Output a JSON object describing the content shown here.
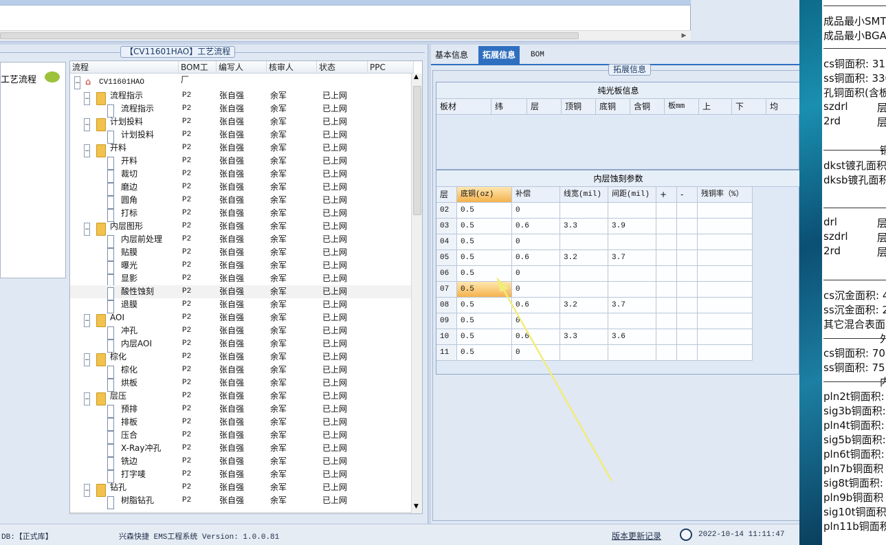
{
  "flow_panel": {
    "title": "【CV11601HAO】工艺流程"
  },
  "left_nav": {
    "label": "工艺流程"
  },
  "tree": {
    "headers": [
      "流程",
      "BOM工厂",
      "编写人",
      "核审人",
      "状态",
      "PPC"
    ],
    "root": "CV11601HAO",
    "rows": [
      {
        "label": "流程指示",
        "level": 1,
        "factory": "P2",
        "writer": "张自强",
        "reviewer": "余军",
        "status": "已上网"
      },
      {
        "label": "流程指示",
        "level": 2,
        "factory": "P2",
        "writer": "张自强",
        "reviewer": "余军",
        "status": "已上网"
      },
      {
        "label": "计划投料",
        "level": 1,
        "factory": "P2",
        "writer": "张自强",
        "reviewer": "余军",
        "status": "已上网"
      },
      {
        "label": "计划投料",
        "level": 2,
        "factory": "P2",
        "writer": "张自强",
        "reviewer": "余军",
        "status": "已上网"
      },
      {
        "label": "开料",
        "level": 1,
        "factory": "P2",
        "writer": "张自强",
        "reviewer": "余军",
        "status": "已上网"
      },
      {
        "label": "开料",
        "level": 2,
        "factory": "P2",
        "writer": "张自强",
        "reviewer": "余军",
        "status": "已上网"
      },
      {
        "label": "裁切",
        "level": 2,
        "factory": "P2",
        "writer": "张自强",
        "reviewer": "余军",
        "status": "已上网"
      },
      {
        "label": "磨边",
        "level": 2,
        "factory": "P2",
        "writer": "张自强",
        "reviewer": "余军",
        "status": "已上网"
      },
      {
        "label": "圆角",
        "level": 2,
        "factory": "P2",
        "writer": "张自强",
        "reviewer": "余军",
        "status": "已上网"
      },
      {
        "label": "打标",
        "level": 2,
        "factory": "P2",
        "writer": "张自强",
        "reviewer": "余军",
        "status": "已上网"
      },
      {
        "label": "内层图形",
        "level": 1,
        "factory": "P2",
        "writer": "张自强",
        "reviewer": "余军",
        "status": "已上网"
      },
      {
        "label": "内层前处理",
        "level": 2,
        "factory": "P2",
        "writer": "张自强",
        "reviewer": "余军",
        "status": "已上网"
      },
      {
        "label": "贴膜",
        "level": 2,
        "factory": "P2",
        "writer": "张自强",
        "reviewer": "余军",
        "status": "已上网"
      },
      {
        "label": "曝光",
        "level": 2,
        "factory": "P2",
        "writer": "张自强",
        "reviewer": "余军",
        "status": "已上网"
      },
      {
        "label": "显影",
        "level": 2,
        "factory": "P2",
        "writer": "张自强",
        "reviewer": "余军",
        "status": "已上网"
      },
      {
        "label": "酸性蚀刻",
        "level": 2,
        "factory": "P2",
        "writer": "张自强",
        "reviewer": "余军",
        "status": "已上网",
        "selected": true
      },
      {
        "label": "退膜",
        "level": 2,
        "factory": "P2",
        "writer": "张自强",
        "reviewer": "余军",
        "status": "已上网"
      },
      {
        "label": "AOI",
        "level": 1,
        "factory": "P2",
        "writer": "张自强",
        "reviewer": "余军",
        "status": "已上网"
      },
      {
        "label": "冲孔",
        "level": 2,
        "factory": "P2",
        "writer": "张自强",
        "reviewer": "余军",
        "status": "已上网"
      },
      {
        "label": "内层AOI",
        "level": 2,
        "factory": "P2",
        "writer": "张自强",
        "reviewer": "余军",
        "status": "已上网"
      },
      {
        "label": "棕化",
        "level": 1,
        "factory": "P2",
        "writer": "张自强",
        "reviewer": "余军",
        "status": "已上网"
      },
      {
        "label": "棕化",
        "level": 2,
        "factory": "P2",
        "writer": "张自强",
        "reviewer": "余军",
        "status": "已上网"
      },
      {
        "label": "烘板",
        "level": 2,
        "factory": "P2",
        "writer": "张自强",
        "reviewer": "余军",
        "status": "已上网"
      },
      {
        "label": "层压",
        "level": 1,
        "factory": "P2",
        "writer": "张自强",
        "reviewer": "余军",
        "status": "已上网"
      },
      {
        "label": "预排",
        "level": 2,
        "factory": "P2",
        "writer": "张自强",
        "reviewer": "余军",
        "status": "已上网"
      },
      {
        "label": "排板",
        "level": 2,
        "factory": "P2",
        "writer": "张自强",
        "reviewer": "余军",
        "status": "已上网"
      },
      {
        "label": "压合",
        "level": 2,
        "factory": "P2",
        "writer": "张自强",
        "reviewer": "余军",
        "status": "已上网"
      },
      {
        "label": "X-Ray冲孔",
        "level": 2,
        "factory": "P2",
        "writer": "张自强",
        "reviewer": "余军",
        "status": "已上网"
      },
      {
        "label": "铣边",
        "level": 2,
        "factory": "P2",
        "writer": "张自强",
        "reviewer": "余军",
        "status": "已上网"
      },
      {
        "label": "打字唛",
        "level": 2,
        "factory": "P2",
        "writer": "张自强",
        "reviewer": "余军",
        "status": "已上网"
      },
      {
        "label": "钻孔",
        "level": 1,
        "factory": "P2",
        "writer": "张自强",
        "reviewer": "余军",
        "status": "已上网"
      },
      {
        "label": "树脂钻孔",
        "level": 2,
        "factory": "P2",
        "writer": "张自强",
        "reviewer": "余军",
        "status": "已上网"
      }
    ]
  },
  "tabs": [
    {
      "label": "基本信息",
      "active": false
    },
    {
      "label": "拓展信息",
      "active": true
    },
    {
      "label": "BOM",
      "active": false
    }
  ],
  "ext": {
    "group_title": "拓展信息"
  },
  "bare_board": {
    "title": "纯光板信息",
    "headers": [
      "板材",
      "纬",
      "层",
      "顶铜",
      "底铜",
      "含铜",
      "板mm",
      "上",
      "下",
      "均"
    ]
  },
  "etch": {
    "title": "内层蚀刻参数",
    "headers": [
      "层",
      "底铜(oz)",
      "补偿",
      "线宽(mil)",
      "间距(mil)",
      "+",
      "-",
      "残铜率（%）"
    ],
    "rows": [
      [
        "02",
        "0.5",
        "0",
        "",
        "",
        "",
        "",
        ""
      ],
      [
        "03",
        "0.5",
        "0.6",
        "3.3",
        "3.9",
        "",
        "",
        ""
      ],
      [
        "04",
        "0.5",
        "0",
        "",
        "",
        "",
        "",
        ""
      ],
      [
        "05",
        "0.5",
        "0.6",
        "3.2",
        "3.7",
        "",
        "",
        ""
      ],
      [
        "06",
        "0.5",
        "0",
        "",
        "",
        "",
        "",
        ""
      ],
      [
        "07",
        "0.5",
        "0",
        "",
        "",
        "",
        "",
        ""
      ],
      [
        "08",
        "0.5",
        "0.6",
        "3.2",
        "3.7",
        "",
        "",
        ""
      ],
      [
        "09",
        "0.5",
        "0",
        "",
        "",
        "",
        "",
        ""
      ],
      [
        "10",
        "0.5",
        "0.6",
        "3.3",
        "3.6",
        "",
        "",
        ""
      ],
      [
        "11",
        "0.5",
        "0",
        "",
        "",
        "",
        "",
        ""
      ]
    ],
    "active_row": 5
  },
  "status_bar": {
    "db": "DB:【正式库】",
    "system": "兴森快捷 EMS工程系统 Version: 1.0.0.81",
    "update_link": "版本更新记录",
    "datetime": "2022-10-14 11:11:47"
  },
  "side_notes": [
    "成品最小SMT",
    "成品最小BGA",
    "cs铜面积: 31",
    "ss铜面积: 330",
    "孔铜面积(含板",
    "szdrl",
    "2rd",
    "dkst镀孔面积",
    "dksb镀孔面积",
    "drl",
    "szdrl",
    "2rd",
    "cs沉金面积: 4",
    "ss沉金面积: 2",
    "其它混合表面",
    "cs铜面积: 70.",
    "ss铜面积: 75.",
    "pln2t铜面积:",
    "sig3b铜面积:",
    "pln4t铜面积:",
    "sig5b铜面积:",
    "pln6t铜面积:",
    "pln7b铜面积",
    "sig8t铜面积:",
    "pln9b铜面积",
    "sig10t铜面积",
    "pln11b铜面积"
  ],
  "side_cols": [
    "层",
    "层",
    "层",
    "层",
    "层"
  ],
  "side_fragments": [
    "铜",
    "外",
    "内"
  ]
}
